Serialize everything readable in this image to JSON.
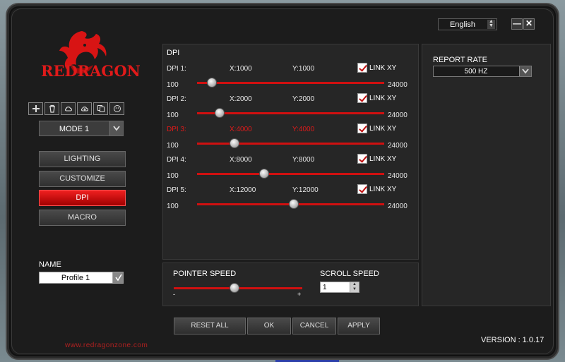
{
  "window": {
    "language": "English",
    "minimize_icon": "minimize-icon",
    "close_icon": "close-icon"
  },
  "brand": {
    "logo_text": "REDRAGON",
    "logo_icon": "dragon-logo-icon",
    "website": "www.redragonzone.com",
    "accent_color": "#e01a1a"
  },
  "toolbar": {
    "icons": [
      "add-profile-icon",
      "delete-profile-icon",
      "cloud-upload-icon",
      "cloud-download-icon",
      "copy-icon",
      "reset-icon"
    ]
  },
  "mode": {
    "selected": "MODE 1"
  },
  "nav": {
    "items": [
      {
        "label": "LIGHTING",
        "active": false
      },
      {
        "label": "CUSTOMIZE",
        "active": false
      },
      {
        "label": "DPI",
        "active": true
      },
      {
        "label": "MACRO",
        "active": false
      }
    ]
  },
  "profile": {
    "label": "NAME",
    "value": "Profile 1"
  },
  "dpi": {
    "title": "DPI",
    "min": "100",
    "max": "24000",
    "link_label": "LINK XY",
    "rows": [
      {
        "name": "DPI 1:",
        "x": "X:1000",
        "y": "Y:1000",
        "linked": true,
        "value": 1000,
        "active": false
      },
      {
        "name": "DPI 2:",
        "x": "X:2000",
        "y": "Y:2000",
        "linked": true,
        "value": 2000,
        "active": false
      },
      {
        "name": "DPI 3:",
        "x": "X:4000",
        "y": "Y:4000",
        "linked": true,
        "value": 4000,
        "active": true
      },
      {
        "name": "DPI 4:",
        "x": "X:8000",
        "y": "Y:8000",
        "linked": true,
        "value": 8000,
        "active": false
      },
      {
        "name": "DPI 5:",
        "x": "X:12000",
        "y": "Y:12000",
        "linked": true,
        "value": 12000,
        "active": false
      }
    ]
  },
  "pointer": {
    "label": "POINTER SPEED",
    "minus": "-",
    "plus": "+",
    "level": 0.47
  },
  "scroll": {
    "label": "SCROLL SPEED",
    "value": "1"
  },
  "report": {
    "label": "REPORT RATE",
    "value": "500 HZ"
  },
  "buttons": {
    "reset": "RESET ALL",
    "ok": "OK",
    "cancel": "CANCEL",
    "apply": "APPLY"
  },
  "version": "VERSION : 1.0.17"
}
